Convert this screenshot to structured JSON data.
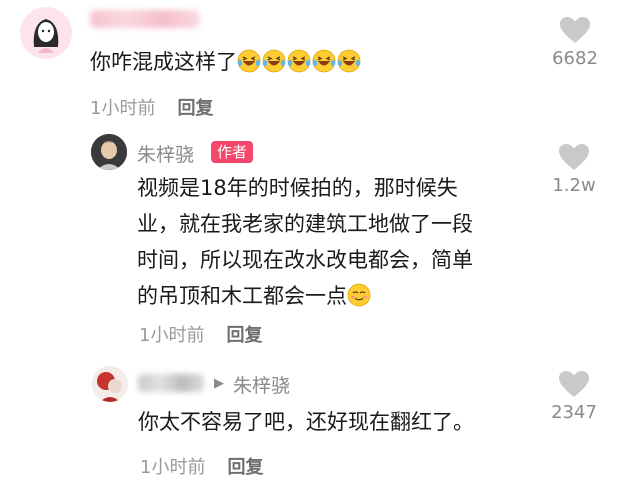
{
  "comments": [
    {
      "username": "",
      "text": "你咋混成这样了",
      "emoji": [
        "laughing-tears-emoji",
        "laughing-tears-emoji",
        "laughing-tears-emoji",
        "laughing-tears-emoji",
        "laughing-tears-emoji"
      ],
      "time": "1小时前",
      "reply_label": "回复",
      "likes": "6682"
    },
    {
      "username": "朱梓骁",
      "badge": "作者",
      "text_lines": [
        "视频是18年的时候拍的，那时候失",
        "业，就在我老家的建筑工地做了一段",
        "时间，所以现在改水改电都会，简单",
        "的吊顶和木工都会一点"
      ],
      "emoji": [
        "relieved-smile-emoji"
      ],
      "time": "1小时前",
      "reply_label": "回复",
      "likes": "1.2w"
    },
    {
      "username": "",
      "reply_to": "朱梓骁",
      "text": "你太不容易了吧，还好现在翻红了。",
      "time": "1小时前",
      "reply_label": "回复",
      "likes": "2347"
    }
  ],
  "colors": {
    "badge": "#f4476b",
    "heart": "#c9c9c9",
    "meta": "#9a9a9a"
  }
}
